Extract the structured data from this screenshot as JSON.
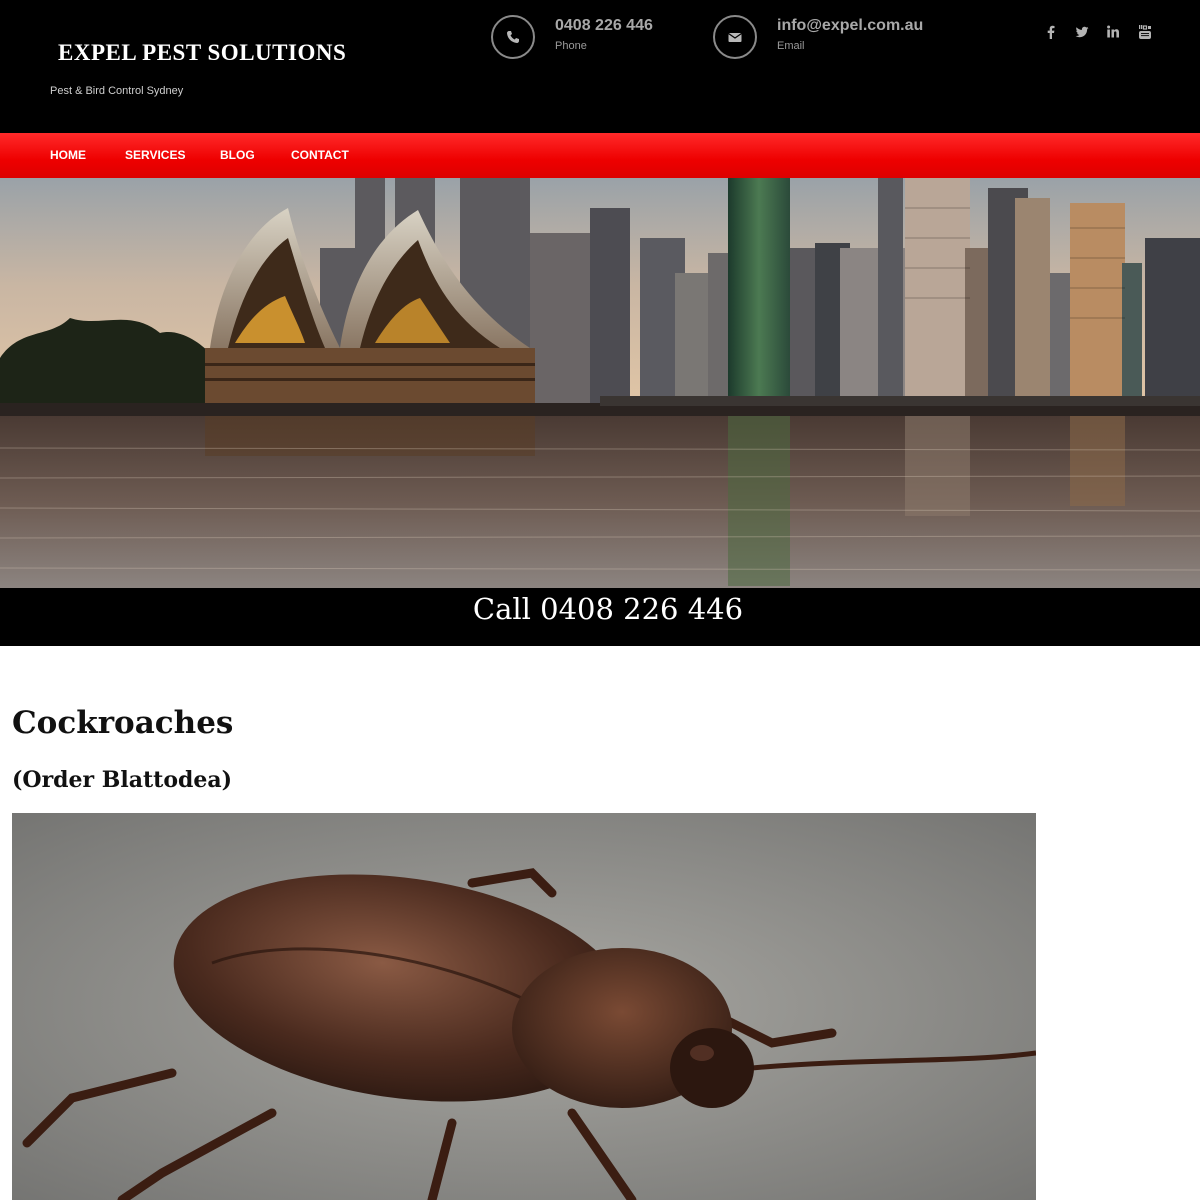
{
  "header": {
    "site_title": "EXPEL PEST SOLUTIONS",
    "tagline": "Pest & Bird Control Sydney",
    "phone": {
      "value": "0408 226 446",
      "label": "Phone",
      "icon": "phone-icon"
    },
    "email": {
      "value": "info@expel.com.au",
      "label": "Email",
      "icon": "envelope-icon"
    },
    "socials": [
      "facebook-icon",
      "twitter-icon",
      "linkedin-icon",
      "youtube-icon"
    ]
  },
  "nav": {
    "items": [
      {
        "label": "HOME"
      },
      {
        "label": "SERVICES"
      },
      {
        "label": "BLOG"
      },
      {
        "label": "CONTACT"
      }
    ]
  },
  "hero": {
    "call_text": "Call 0408 226 446"
  },
  "main": {
    "title": "Cockroaches",
    "subtitle": "(Order Blattodea)"
  },
  "colors": {
    "nav_red": "#ee0000",
    "header_bg": "#000000",
    "text_dark": "#111111"
  }
}
